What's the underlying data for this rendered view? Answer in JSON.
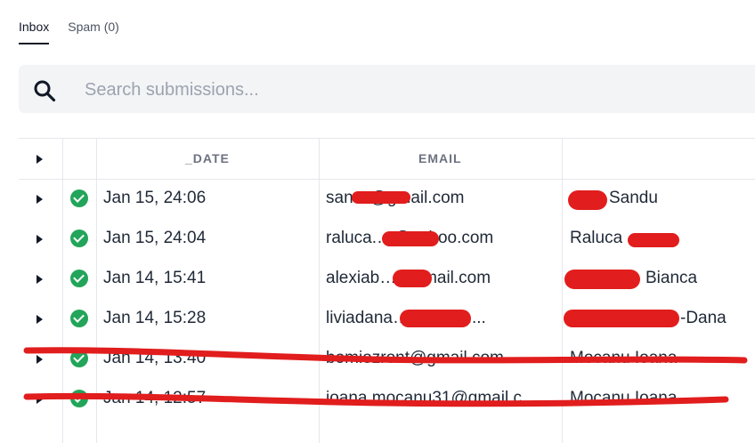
{
  "tabs": [
    {
      "label": "Inbox",
      "active": true
    },
    {
      "label": "Spam (0)",
      "active": false
    }
  ],
  "search": {
    "placeholder": "Search submissions...",
    "value": ""
  },
  "table": {
    "columns": [
      "",
      "",
      "_DATE",
      "EMAIL",
      ""
    ],
    "rows": [
      {
        "status": "check-icon",
        "date": "Jan 15, 24:06",
        "email": "san…@gmail.com",
        "name": "Sandu"
      },
      {
        "status": "check-icon",
        "date": "Jan 15, 24:04",
        "email": "raluca.…@yahoo.com",
        "name": "Raluca"
      },
      {
        "status": "check-icon",
        "date": "Jan 14, 15:41",
        "email": "alexiab…@gmail.com",
        "name": "Bianca"
      },
      {
        "status": "check-icon",
        "date": "Jan 14, 15:28",
        "email": "liviadana…@gmail....",
        "name": "-Dana"
      },
      {
        "status": "check-icon",
        "date": "Jan 14, 13:40",
        "email": "bomiozront@gmail.com",
        "name": "Mocanu Ioana"
      },
      {
        "status": "check-icon",
        "date": "Jan 14, 12:57",
        "email": "ioana.mocanu31@gmail.c",
        "name": "Mocanu Ioana"
      }
    ]
  },
  "colors": {
    "accent": "#111827",
    "success": "#22a55a",
    "redaction": "#e11d1d"
  }
}
